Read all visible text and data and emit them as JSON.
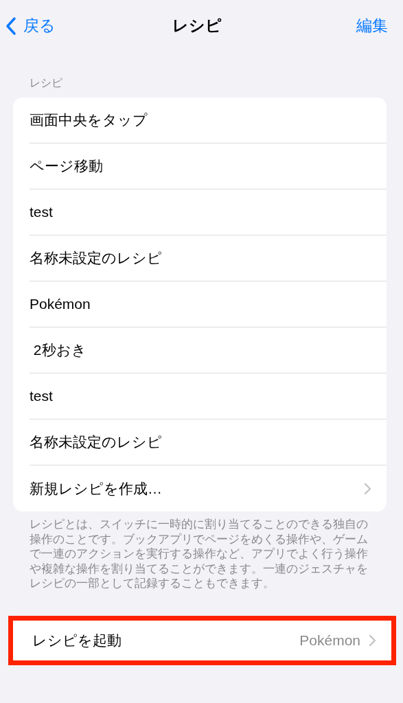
{
  "nav": {
    "back": "戻る",
    "title": "レシピ",
    "action": "編集"
  },
  "section": {
    "header": "レシピ",
    "items": [
      {
        "label": "画面中央をタップ",
        "kind": "plain"
      },
      {
        "label": "ページ移動",
        "kind": "plain"
      },
      {
        "label": "test",
        "kind": "plain"
      },
      {
        "label": "名称未設定のレシピ",
        "kind": "plain"
      },
      {
        "label": "Pokémon",
        "kind": "plain"
      },
      {
        "label": " 2秒おき",
        "kind": "plain"
      },
      {
        "label": "test",
        "kind": "plain"
      },
      {
        "label": "名称未設定のレシピ",
        "kind": "plain"
      },
      {
        "label": "新規レシピを作成…",
        "kind": "disclosure"
      }
    ],
    "footer": "レシピとは、スイッチに一時的に割り当てることのできる独自の操作のことです。ブックアプリでページをめくる操作や、ゲームで一連のアクションを実行する操作など、アプリでよく行う操作や複雑な操作を割り当てることができます。一連のジェスチャをレシピの一部として記録することもできます。"
  },
  "launch": {
    "label": "レシピを起動",
    "value": "Pokémon",
    "highlighted": true
  }
}
